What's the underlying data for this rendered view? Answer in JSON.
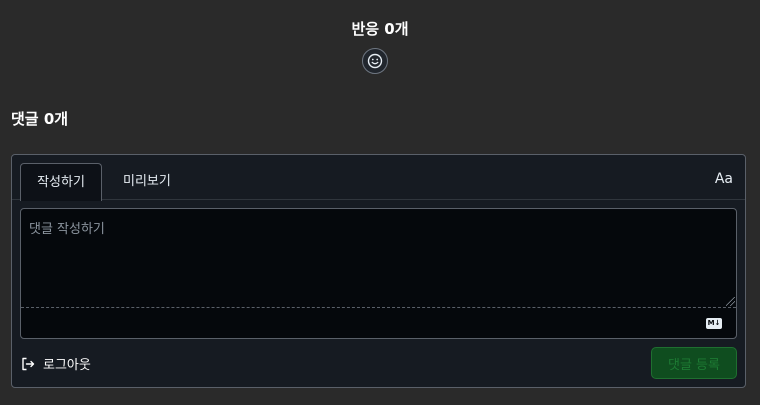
{
  "reactions": {
    "title": "반응 0개",
    "add_icon": "smiley-icon"
  },
  "comments": {
    "title": "댓글 0개",
    "tabs": [
      {
        "label": "작성하기",
        "active": true
      },
      {
        "label": "미리보기",
        "active": false
      }
    ],
    "font_toggle_label": "Aa",
    "editor": {
      "placeholder": "댓글 작성하기",
      "value": "",
      "markdown_badge": "M↓"
    },
    "logout": {
      "icon": "sign-out-icon",
      "label": "로그아웃"
    },
    "submit_label": "댓글 등록"
  },
  "colors": {
    "page_background": "#2a2a2a",
    "panel_background": "#161b22",
    "editor_background": "#05080c",
    "submit_background": "#0f4d1f",
    "submit_text": "#1d7a33"
  }
}
